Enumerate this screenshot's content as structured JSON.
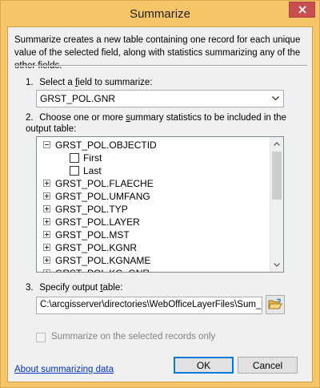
{
  "window": {
    "title": "Summarize",
    "close_icon": "close-x-icon",
    "frame_color": "#f6c567",
    "close_color": "#c7504f"
  },
  "description": "Summarize creates a new table containing one record for each unique value of the selected field, along with statistics summarizing any of the other fields.",
  "step1": {
    "number": "1.",
    "label_before": "Select a ",
    "label_accel": "f",
    "label_after": "ield to summarize:",
    "selected_field": "GRST_POL.GNR"
  },
  "step2": {
    "number": "2.",
    "label_before": "Choose one or more ",
    "label_accel": "s",
    "label_after": "ummary statistics to be included in the output table:",
    "tree": [
      {
        "label": "GRST_POL.OBJECTID",
        "expanded": true,
        "children": [
          {
            "label": "First",
            "checked": false
          },
          {
            "label": "Last",
            "checked": false
          }
        ]
      },
      {
        "label": "GRST_POL.FLAECHE",
        "expanded": false
      },
      {
        "label": "GRST_POL.UMFANG",
        "expanded": false
      },
      {
        "label": "GRST_POL.TYP",
        "expanded": false
      },
      {
        "label": "GRST_POL.LAYER",
        "expanded": false
      },
      {
        "label": "GRST_POL.MST",
        "expanded": false
      },
      {
        "label": "GRST_POL.KGNR",
        "expanded": false
      },
      {
        "label": "GRST_POL.KGNAME",
        "expanded": false
      },
      {
        "label": "GRST_POL.KG_GNR",
        "expanded": false
      }
    ]
  },
  "step3": {
    "number": "3.",
    "label_before": "Specify output ",
    "label_accel": "t",
    "label_after": "able:",
    "output_path": "C:\\arcgisserver\\directories\\WebOfficeLayerFiles\\Sum_Output.dbf",
    "browse_icon": "open-folder-icon"
  },
  "selected_only": {
    "label": "Summarize on the selected records only",
    "checked": false,
    "enabled": false
  },
  "footer": {
    "help_link": "About summarizing data",
    "ok_label": "OK",
    "cancel_label": "Cancel"
  }
}
